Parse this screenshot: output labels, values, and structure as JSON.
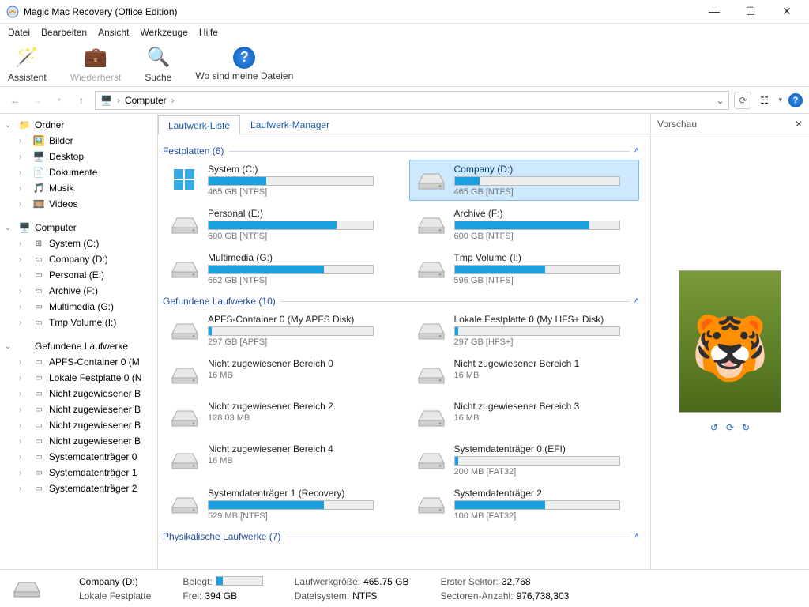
{
  "window": {
    "title": "Magic Mac Recovery (Office Edition)"
  },
  "menu": [
    "Datei",
    "Bearbeiten",
    "Ansicht",
    "Werkzeuge",
    "Hilfe"
  ],
  "toolbar": {
    "assistent": "Assistent",
    "wiederherst": "Wiederherst",
    "suche": "Suche",
    "wosind": "Wo sind meine Dateien"
  },
  "breadcrumb": {
    "root": "Computer"
  },
  "sidebar": {
    "ordner": "Ordner",
    "folders": [
      "Bilder",
      "Desktop",
      "Dokumente",
      "Musik",
      "Videos"
    ],
    "computer": "Computer",
    "drives": [
      "System (C:)",
      "Company (D:)",
      "Personal (E:)",
      "Archive (F:)",
      "Multimedia (G:)",
      "Tmp Volume (I:)"
    ],
    "found": "Gefundene Laufwerke",
    "found_items": [
      "APFS-Container 0 (M",
      "Lokale Festplatte 0 (N",
      "Nicht zugewiesener B",
      "Nicht zugewiesener B",
      "Nicht zugewiesener B",
      "Nicht zugewiesener B",
      "Systemdatenträger 0",
      "Systemdatenträger 1",
      "Systemdatenträger 2"
    ]
  },
  "tabs": {
    "list": "Laufwerk-Liste",
    "manager": "Laufwerk-Manager"
  },
  "sections": {
    "hdd": "Festplatten (6)",
    "found": "Gefundene Laufwerke (10)",
    "phys": "Physikalische Laufwerke (7)"
  },
  "hdds": [
    {
      "name": "System (C:)",
      "sub": "465 GB [NTFS]",
      "fill": 35,
      "win": true
    },
    {
      "name": "Company (D:)",
      "sub": "465 GB [NTFS]",
      "fill": 15,
      "selected": true
    },
    {
      "name": "Personal (E:)",
      "sub": "600 GB [NTFS]",
      "fill": 78
    },
    {
      "name": "Archive (F:)",
      "sub": "600 GB [NTFS]",
      "fill": 82
    },
    {
      "name": "Multimedia (G:)",
      "sub": "662 GB [NTFS]",
      "fill": 70
    },
    {
      "name": "Tmp Volume (I:)",
      "sub": "596 GB [NTFS]",
      "fill": 55
    }
  ],
  "founds": [
    {
      "name": "APFS-Container 0 (My APFS Disk)",
      "sub": "297 GB [APFS]",
      "fill": 2
    },
    {
      "name": "Lokale Festplatte 0 (My HFS+ Disk)",
      "sub": "297 GB [HFS+]",
      "fill": 2
    },
    {
      "name": "Nicht zugewiesener Bereich 0",
      "sub": "16 MB",
      "nobar": true
    },
    {
      "name": "Nicht zugewiesener Bereich 1",
      "sub": "16 MB",
      "nobar": true
    },
    {
      "name": "Nicht zugewiesener Bereich 2",
      "sub": "128.03 MB",
      "nobar": true
    },
    {
      "name": "Nicht zugewiesener Bereich 3",
      "sub": "16 MB",
      "nobar": true
    },
    {
      "name": "Nicht zugewiesener Bereich 4",
      "sub": "16 MB",
      "nobar": true
    },
    {
      "name": "Systemdatenträger 0 (EFI)",
      "sub": "200 MB [FAT32]",
      "fill": 2
    },
    {
      "name": "Systemdatenträger 1 (Recovery)",
      "sub": "529 MB [NTFS]",
      "fill": 70
    },
    {
      "name": "Systemdatenträger 2",
      "sub": "100 MB [FAT32]",
      "fill": 55
    }
  ],
  "preview": {
    "title": "Vorschau"
  },
  "status": {
    "name": "Company (D:)",
    "type": "Lokale Festplatte",
    "belegt_label": "Belegt:",
    "frei_label": "Frei:",
    "frei_val": "394 GB",
    "size_label": "Laufwerkgröße:",
    "size_val": "465.75 GB",
    "fs_label": "Dateisystem:",
    "fs_val": "NTFS",
    "sector_label": "Erster Sektor:",
    "sector_val": "32,768",
    "count_label": "Sectoren-Anzahl:",
    "count_val": "976,738,303"
  }
}
